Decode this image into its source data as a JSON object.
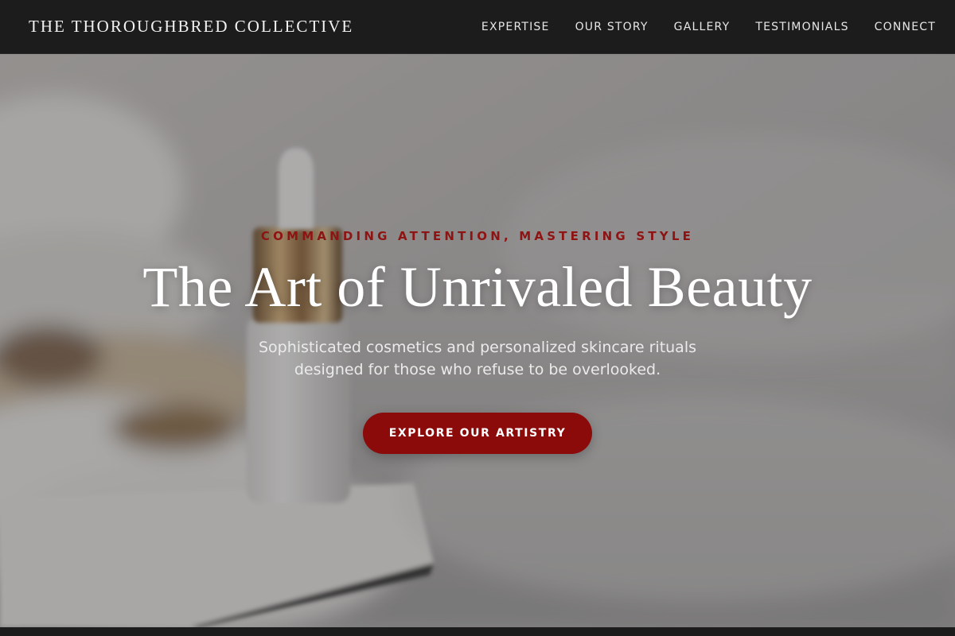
{
  "header": {
    "brand": "THE THOROUGHBRED COLLECTIVE",
    "nav": [
      {
        "label": "EXPERTISE"
      },
      {
        "label": "OUR STORY"
      },
      {
        "label": "GALLERY"
      },
      {
        "label": "TESTIMONIALS"
      },
      {
        "label": "CONNECT"
      }
    ]
  },
  "hero": {
    "eyebrow": "COMMANDING ATTENTION, MASTERING STYLE",
    "title": "The Art of Unrivaled Beauty",
    "subtitle": "Sophisticated cosmetics and personalized skincare rituals designed for those who refuse to be overlooked.",
    "cta_label": "EXPLORE OUR ARTISTRY",
    "background_image": "serum-dropper-bottle-photo"
  },
  "colors": {
    "nav_background": "#1c1c1c",
    "accent_red": "#8b0a0a",
    "eyebrow_red": "#8e1414",
    "text_light": "#ffffff"
  }
}
